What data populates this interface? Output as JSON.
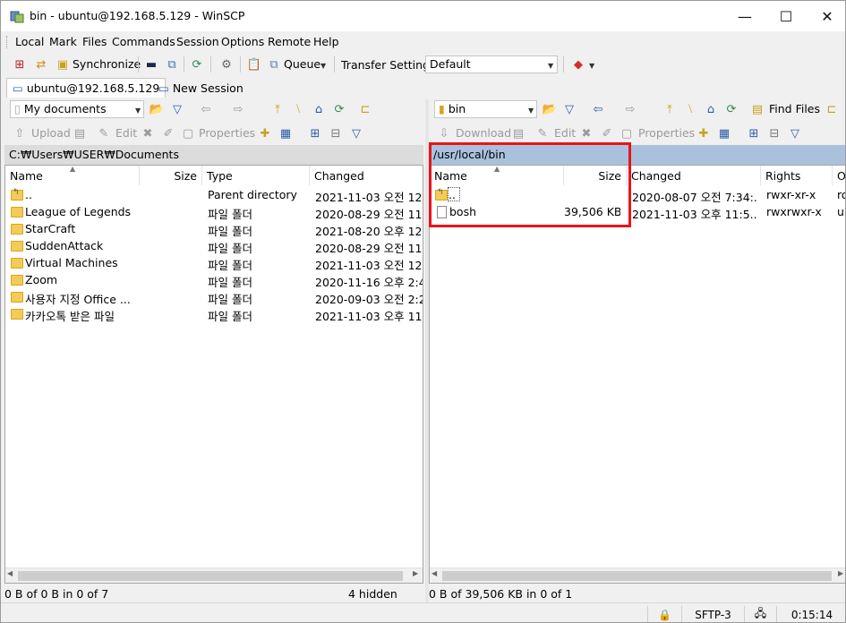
{
  "window": {
    "title": "bin - ubuntu@192.168.5.129 - WinSCP",
    "controls": {
      "minimize": "—",
      "maximize": "☐",
      "close": "✕"
    }
  },
  "menu": [
    "Local",
    "Mark",
    "Files",
    "Commands",
    "Session",
    "Options",
    "Remote",
    "Help"
  ],
  "toolbar": {
    "synchronize": "Synchronize",
    "queue": "Queue",
    "transfer_settings": "Transfer Settings",
    "transfer_profile": "Default"
  },
  "tabs": {
    "session": "ubuntu@192.168.5.129",
    "new_session": "New Session"
  },
  "left": {
    "location": "My documents",
    "path": "C:₩Users₩USER₩Documents",
    "actions": {
      "upload": "Upload",
      "edit": "Edit",
      "properties": "Properties"
    },
    "columns": {
      "name": "Name",
      "size": "Size",
      "type": "Type",
      "changed": "Changed"
    },
    "files": [
      {
        "name": "..",
        "size": "",
        "type": "Parent directory",
        "changed": "2021-11-03  오전 12:"
      },
      {
        "name": "League of Legends",
        "size": "",
        "type": "파일 폴더",
        "changed": "2020-08-29  오전 11:"
      },
      {
        "name": "StarCraft",
        "size": "",
        "type": "파일 폴더",
        "changed": "2021-08-20  오후 12:"
      },
      {
        "name": "SuddenAttack",
        "size": "",
        "type": "파일 폴더",
        "changed": "2020-08-29  오전 11:"
      },
      {
        "name": "Virtual Machines",
        "size": "",
        "type": "파일 폴더",
        "changed": "2021-11-03  오전 12:"
      },
      {
        "name": "Zoom",
        "size": "",
        "type": "파일 폴더",
        "changed": "2020-11-16  오후 2:4"
      },
      {
        "name": "사용자 지정 Office ...",
        "size": "",
        "type": "파일 폴더",
        "changed": "2020-09-03  오전 2:2"
      },
      {
        "name": "카카오톡 받은 파일",
        "size": "",
        "type": "파일 폴더",
        "changed": "2021-11-03  오후 11:"
      }
    ],
    "status": "0 B of 0 B in 0 of 7",
    "hidden": "4 hidden"
  },
  "right": {
    "location": "bin",
    "path": "/usr/local/bin",
    "actions": {
      "download": "Download",
      "edit": "Edit",
      "properties": "Properties"
    },
    "find_files": "Find Files",
    "columns": {
      "name": "Name",
      "size": "Size",
      "changed": "Changed",
      "rights": "Rights",
      "owner": "O"
    },
    "files": [
      {
        "name": "..",
        "size": "",
        "changed": "2020-08-07  오전 7:34:...",
        "rights": "rwxr-xr-x",
        "owner": "ro"
      },
      {
        "name": "bosh",
        "size": "39,506 KB",
        "changed": "2021-11-03  오후 11:5...",
        "rights": "rwxrwxr-x",
        "owner": "ub"
      }
    ],
    "status": "0 B of 39,506 KB in 0 of 1"
  },
  "statusbar": {
    "protocol": "SFTP-3",
    "elapsed": "0:15:14"
  },
  "colors": {
    "highlight": "#e8141b",
    "remote_path_bar": "#a9c1dd",
    "folder": "#f3cb56"
  }
}
